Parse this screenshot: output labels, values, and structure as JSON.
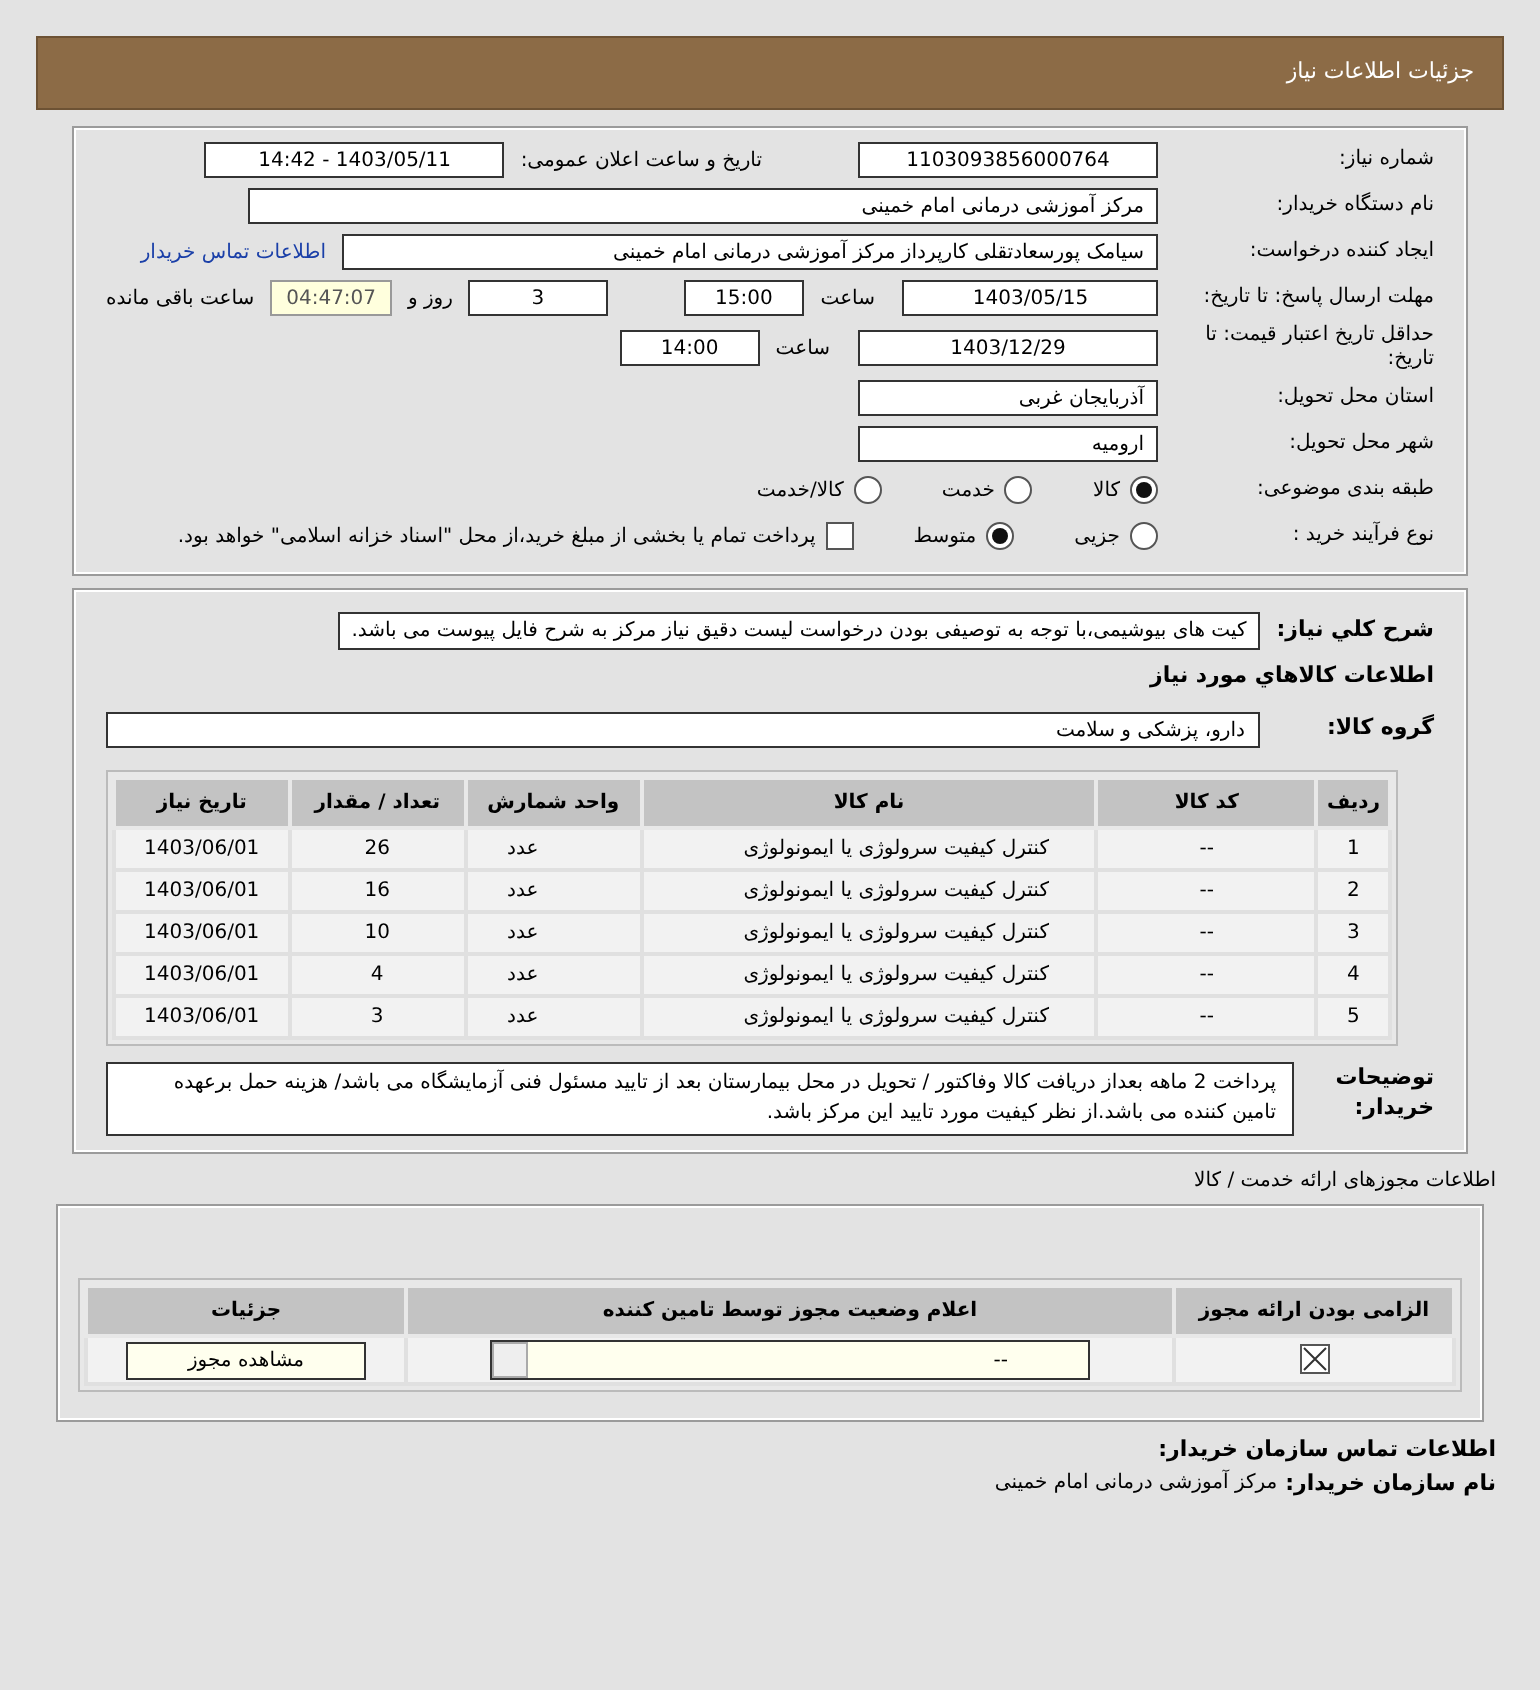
{
  "header": {
    "title": "جزئیات اطلاعات نیاز"
  },
  "details": {
    "need_number": {
      "label": "شماره نیاز:",
      "value": "1103093856000764"
    },
    "announce": {
      "label": "تاریخ و ساعت اعلان عمومی:",
      "value": "1403/05/11 - 14:42"
    },
    "buyer": {
      "label": "نام دستگاه خریدار:",
      "value": "مرکز آموزشی درمانی امام خمینی"
    },
    "creator": {
      "label": "ایجاد کننده درخواست:",
      "value": "سیامک پورسعادتقلی کارپرداز مرکز آموزشی درمانی امام خمینی",
      "link": "اطلاعات تماس خریدار"
    },
    "deadline": {
      "label": "مهلت ارسال پاسخ: تا تاریخ:",
      "date": "1403/05/15",
      "time_label": "ساعت",
      "time": "15:00",
      "days": "3",
      "days_label": "روز و",
      "remaining": "04:47:07",
      "remaining_label": "ساعت باقی مانده"
    },
    "validity": {
      "label": "حداقل تاریخ اعتبار قیمت: تا تاریخ:",
      "date": "1403/12/29",
      "time_label": "ساعت",
      "time": "14:00"
    },
    "province": {
      "label": "استان محل تحویل:",
      "value": "آذربایجان غربی"
    },
    "city": {
      "label": "شهر محل تحویل:",
      "value": "ارومیه"
    },
    "category": {
      "label": "طبقه بندی موضوعی:",
      "options": [
        {
          "label": "کالا",
          "selected": true
        },
        {
          "label": "خدمت",
          "selected": false
        },
        {
          "label": "کالا/خدمت",
          "selected": false
        }
      ]
    },
    "process": {
      "label": "نوع فرآیند خرید :",
      "options": [
        {
          "label": "جزیی",
          "selected": false
        },
        {
          "label": "متوسط",
          "selected": true
        }
      ],
      "treasury": {
        "label": "پرداخت تمام یا بخشی از مبلغ خرید،از محل \"اسناد خزانه اسلامی\" خواهد بود.",
        "checked": false
      }
    }
  },
  "needs": {
    "description": {
      "label": "شرح کلي نياز:",
      "value": "کیت های بیوشیمی،با توجه به توصیفی بودن درخواست لیست دقیق نیاز مرکز به شرح فایل پیوست می باشد."
    },
    "goods_title": "اطلاعات کالاهاي مورد نياز",
    "goods_group": {
      "label": "گروه کالا:",
      "value": "دارو، پزشکی و سلامت"
    },
    "table": {
      "columns": [
        "ردیف",
        "کد کالا",
        "نام کالا",
        "واحد شمارش",
        "تعداد / مقدار",
        "تاریخ نیاز"
      ],
      "rows": [
        [
          "1",
          "--",
          "کنترل کیفیت سرولوژی یا ایمونولوژی",
          "عدد",
          "26",
          "1403/06/01"
        ],
        [
          "2",
          "--",
          "کنترل کیفیت سرولوژی یا ایمونولوژی",
          "عدد",
          "16",
          "1403/06/01"
        ],
        [
          "3",
          "--",
          "کنترل کیفیت سرولوژی یا ایمونولوژی",
          "عدد",
          "10",
          "1403/06/01"
        ],
        [
          "4",
          "--",
          "کنترل کیفیت سرولوژی یا ایمونولوژی",
          "عدد",
          "4",
          "1403/06/01"
        ],
        [
          "5",
          "--",
          "کنترل کیفیت سرولوژی یا ایمونولوژی",
          "عدد",
          "3",
          "1403/06/01"
        ]
      ]
    },
    "buyer_notes": {
      "label": "توضیحات خریدار:",
      "value": "پرداخت 2 ماهه بعداز دریافت کالا وفاکتور / تحویل در محل بیمارستان بعد از تایید مسئول فنی آزمایشگاه می باشد/ هزینه حمل برعهده تامین کننده می باشد.از نظر کیفیت مورد تایید این مرکز باشد."
    }
  },
  "permits": {
    "title": "اطلاعات مجوزهای ارائه خدمت / کالا",
    "columns": [
      "الزامی بودن ارائه مجوز",
      "اعلام وضعیت مجوز توسط تامین کننده",
      "جزئیات"
    ],
    "rows": [
      {
        "required": true,
        "status": "--",
        "button": "مشاهده مجوز"
      }
    ]
  },
  "contact": {
    "title": "اطلاعات تماس سازمان خریدار:",
    "rows": [
      {
        "label": "نام سازمان خریدار:",
        "value": "مرکز آموزشی درمانی امام خمینی"
      }
    ]
  }
}
